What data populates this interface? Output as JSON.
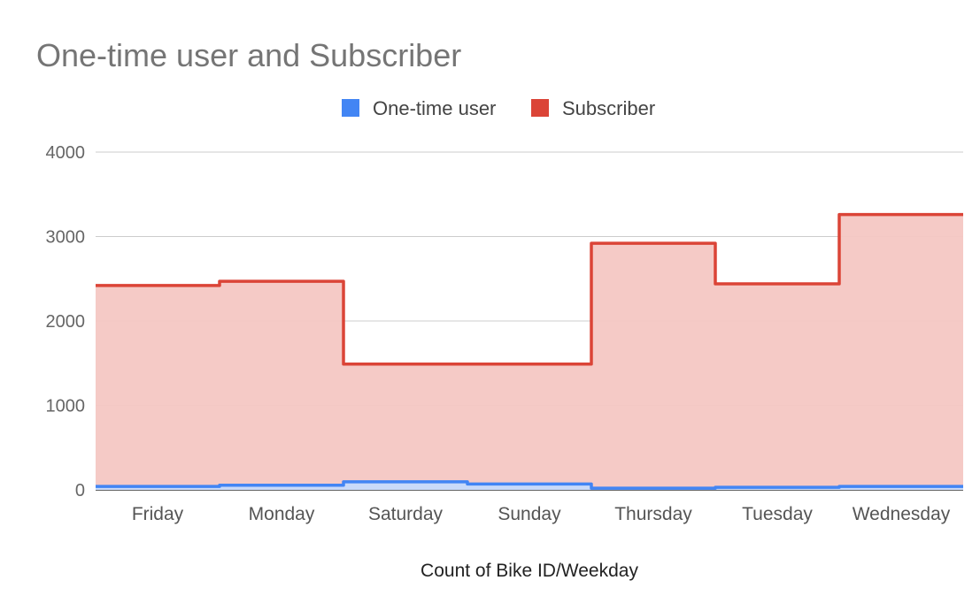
{
  "chart_data": {
    "type": "area",
    "title": "One-time user and Subscriber",
    "xlabel": "Count of Bike ID/Weekday",
    "ylabel": "",
    "categories": [
      "Friday",
      "Monday",
      "Saturday",
      "Sunday",
      "Thursday",
      "Tuesday",
      "Wednesday"
    ],
    "series": [
      {
        "name": "One-time user",
        "color": "#4285f4",
        "values": [
          40,
          55,
          95,
          70,
          20,
          30,
          40
        ]
      },
      {
        "name": "Subscriber",
        "color": "#db4437",
        "values": [
          2420,
          2470,
          1490,
          1490,
          2920,
          2440,
          3260
        ]
      }
    ],
    "step": true,
    "ylim": [
      0,
      4000
    ],
    "yticks": [
      0,
      1000,
      2000,
      3000,
      4000
    ],
    "grid": true,
    "legend": "top-center"
  }
}
